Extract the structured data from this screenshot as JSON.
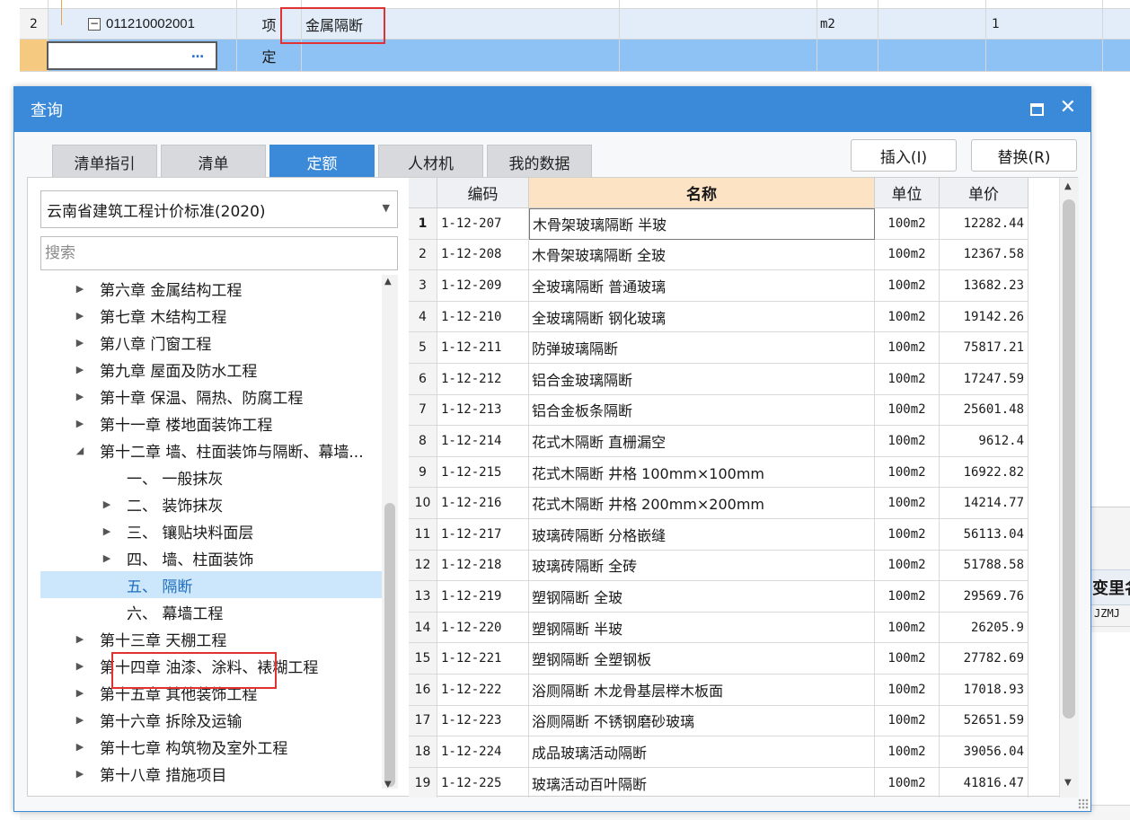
{
  "bg": {
    "row_num": "2",
    "code": "011210002001",
    "type": "项",
    "name": "金属隔断",
    "unit": "m2",
    "qty": "1",
    "row3_type": "定",
    "edit_dots": "…",
    "right_head": "变里名",
    "right_value": "JZMJ"
  },
  "dialog": {
    "title": "查询",
    "tabs": [
      {
        "label": "清单指引",
        "active": false
      },
      {
        "label": "清单",
        "active": false
      },
      {
        "label": "定额",
        "active": true
      },
      {
        "label": "人材机",
        "active": false
      },
      {
        "label": "我的数据",
        "active": false
      }
    ],
    "insert_label": "插入(I)",
    "replace_label": "替换(R)",
    "standard": "云南省建筑工程计价标准(2020)",
    "search_placeholder": "搜索"
  },
  "tree": [
    {
      "text": "第六章 金属结构工程",
      "level": 0,
      "arrow": "right"
    },
    {
      "text": "第七章 木结构工程",
      "level": 0,
      "arrow": "right"
    },
    {
      "text": "第八章 门窗工程",
      "level": 0,
      "arrow": "right"
    },
    {
      "text": "第九章 屋面及防水工程",
      "level": 0,
      "arrow": "right"
    },
    {
      "text": "第十章 保温、隔热、防腐工程",
      "level": 0,
      "arrow": "right"
    },
    {
      "text": "第十一章 楼地面装饰工程",
      "level": 0,
      "arrow": "right"
    },
    {
      "text": "第十二章 墙、柱面装饰与隔断、幕墙...",
      "level": 0,
      "arrow": "down"
    },
    {
      "text": "一、 一般抹灰",
      "level": 1,
      "arrow": "none"
    },
    {
      "text": "二、 装饰抹灰",
      "level": 1,
      "arrow": "right"
    },
    {
      "text": "三、 镶贴块料面层",
      "level": 1,
      "arrow": "right"
    },
    {
      "text": "四、 墙、柱面装饰",
      "level": 1,
      "arrow": "right"
    },
    {
      "text": "五、 隔断",
      "level": 1,
      "arrow": "none",
      "selected": true
    },
    {
      "text": "六、 幕墙工程",
      "level": 1,
      "arrow": "none"
    },
    {
      "text": "第十三章 天棚工程",
      "level": 0,
      "arrow": "right"
    },
    {
      "text": "第十四章 油漆、涂料、裱糊工程",
      "level": 0,
      "arrow": "right"
    },
    {
      "text": "第十五章 其他装饰工程",
      "level": 0,
      "arrow": "right"
    },
    {
      "text": "第十六章 拆除及运输",
      "level": 0,
      "arrow": "right"
    },
    {
      "text": "第十七章 构筑物及室外工程",
      "level": 0,
      "arrow": "right"
    },
    {
      "text": "第十八章 措施项目",
      "level": 0,
      "arrow": "right"
    }
  ],
  "grid": {
    "headers": {
      "code": "编码",
      "name": "名称",
      "unit": "单位",
      "price": "单价"
    },
    "rows": [
      {
        "n": "1",
        "code": "1-12-207",
        "name": "木骨架玻璃隔断 半玻",
        "unit": "100m2",
        "price": "12282.44"
      },
      {
        "n": "2",
        "code": "1-12-208",
        "name": "木骨架玻璃隔断 全玻",
        "unit": "100m2",
        "price": "12367.58"
      },
      {
        "n": "3",
        "code": "1-12-209",
        "name": "全玻璃隔断 普通玻璃",
        "unit": "100m2",
        "price": "13682.23"
      },
      {
        "n": "4",
        "code": "1-12-210",
        "name": "全玻璃隔断 钢化玻璃",
        "unit": "100m2",
        "price": "19142.26"
      },
      {
        "n": "5",
        "code": "1-12-211",
        "name": "防弹玻璃隔断",
        "unit": "100m2",
        "price": "75817.21"
      },
      {
        "n": "6",
        "code": "1-12-212",
        "name": "铝合金玻璃隔断",
        "unit": "100m2",
        "price": "17247.59"
      },
      {
        "n": "7",
        "code": "1-12-213",
        "name": "铝合金板条隔断",
        "unit": "100m2",
        "price": "25601.48"
      },
      {
        "n": "8",
        "code": "1-12-214",
        "name": "花式木隔断 直栅漏空",
        "unit": "100m2",
        "price": "9612.4"
      },
      {
        "n": "9",
        "code": "1-12-215",
        "name": "花式木隔断 井格 100mm×100mm",
        "unit": "100m2",
        "price": "16922.82"
      },
      {
        "n": "10",
        "code": "1-12-216",
        "name": "花式木隔断 井格 200mm×200mm",
        "unit": "100m2",
        "price": "14214.77"
      },
      {
        "n": "11",
        "code": "1-12-217",
        "name": "玻璃砖隔断 分格嵌缝",
        "unit": "100m2",
        "price": "56113.04"
      },
      {
        "n": "12",
        "code": "1-12-218",
        "name": "玻璃砖隔断 全砖",
        "unit": "100m2",
        "price": "51788.58"
      },
      {
        "n": "13",
        "code": "1-12-219",
        "name": "塑钢隔断 全玻",
        "unit": "100m2",
        "price": "29569.76"
      },
      {
        "n": "14",
        "code": "1-12-220",
        "name": "塑钢隔断 半玻",
        "unit": "100m2",
        "price": "26205.9"
      },
      {
        "n": "15",
        "code": "1-12-221",
        "name": "塑钢隔断 全塑钢板",
        "unit": "100m2",
        "price": "27782.69"
      },
      {
        "n": "16",
        "code": "1-12-222",
        "name": "浴厕隔断 木龙骨基层榉木板面",
        "unit": "100m2",
        "price": "17018.93"
      },
      {
        "n": "17",
        "code": "1-12-223",
        "name": "浴厕隔断 不锈钢磨砂玻璃",
        "unit": "100m2",
        "price": "52651.59"
      },
      {
        "n": "18",
        "code": "1-12-224",
        "name": "成品玻璃活动隔断",
        "unit": "100m2",
        "price": "39056.04"
      },
      {
        "n": "19",
        "code": "1-12-225",
        "name": "玻璃活动百叶隔断",
        "unit": "100m2",
        "price": "41816.47"
      }
    ]
  },
  "colors": {
    "accent": "#3b8ad9",
    "highlight_box": "#e03232",
    "tree_selected": "#cce6fb",
    "name_header": "#fce3c4"
  }
}
